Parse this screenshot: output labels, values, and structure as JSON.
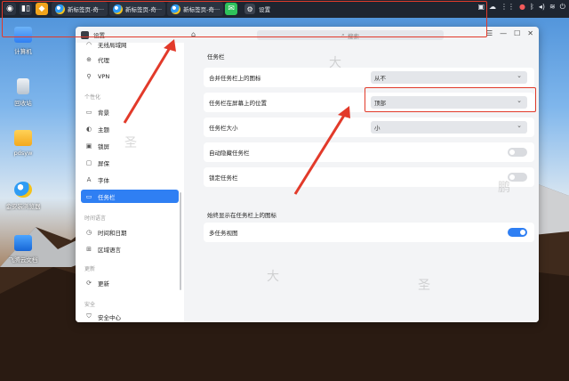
{
  "taskbar": {
    "tasks": [
      {
        "label": "新标签页-奇···"
      },
      {
        "label": "新标签页-奇···"
      },
      {
        "label": "新标签页-奇···"
      },
      {
        "label": "设置"
      }
    ]
  },
  "desktop": {
    "icons": [
      {
        "label": "计算机"
      },
      {
        "label": "回收站"
      },
      {
        "label": "pdsyw"
      },
      {
        "label": "金安装浏览器"
      },
      {
        "label": "飞腾云文档"
      }
    ]
  },
  "window": {
    "title": "设置",
    "search_placeholder": "搜索"
  },
  "sidebar": {
    "items": [
      {
        "label": "无线局域网"
      },
      {
        "label": "代理"
      },
      {
        "label": "VPN"
      },
      {
        "label": "背景"
      },
      {
        "label": "主题"
      },
      {
        "label": "锁屏"
      },
      {
        "label": "屏保"
      },
      {
        "label": "字体"
      },
      {
        "label": "任务栏"
      },
      {
        "label": "时间和日期"
      },
      {
        "label": "区域语言"
      },
      {
        "label": "更新"
      },
      {
        "label": "安全中心"
      }
    ],
    "categories": [
      "个性化",
      "时间语言",
      "更新",
      "安全"
    ]
  },
  "content": {
    "section_title": "任务栏",
    "rows": [
      {
        "label": "合并任务栏上的图标",
        "value": "从不"
      },
      {
        "label": "任务栏在屏幕上的位置",
        "value": "顶部"
      },
      {
        "label": "任务栏大小",
        "value": "小"
      },
      {
        "label": "自动隐藏任务栏"
      },
      {
        "label": "锁定任务栏"
      }
    ],
    "section2_title": "始终显示在任务栏上的图标",
    "multitask_label": "多任务视图"
  },
  "toggles": {
    "auto_hide": false,
    "lock": false,
    "multitask": true
  },
  "colors": {
    "accent": "#2f7ff3",
    "annotation": "#e23a2a"
  }
}
